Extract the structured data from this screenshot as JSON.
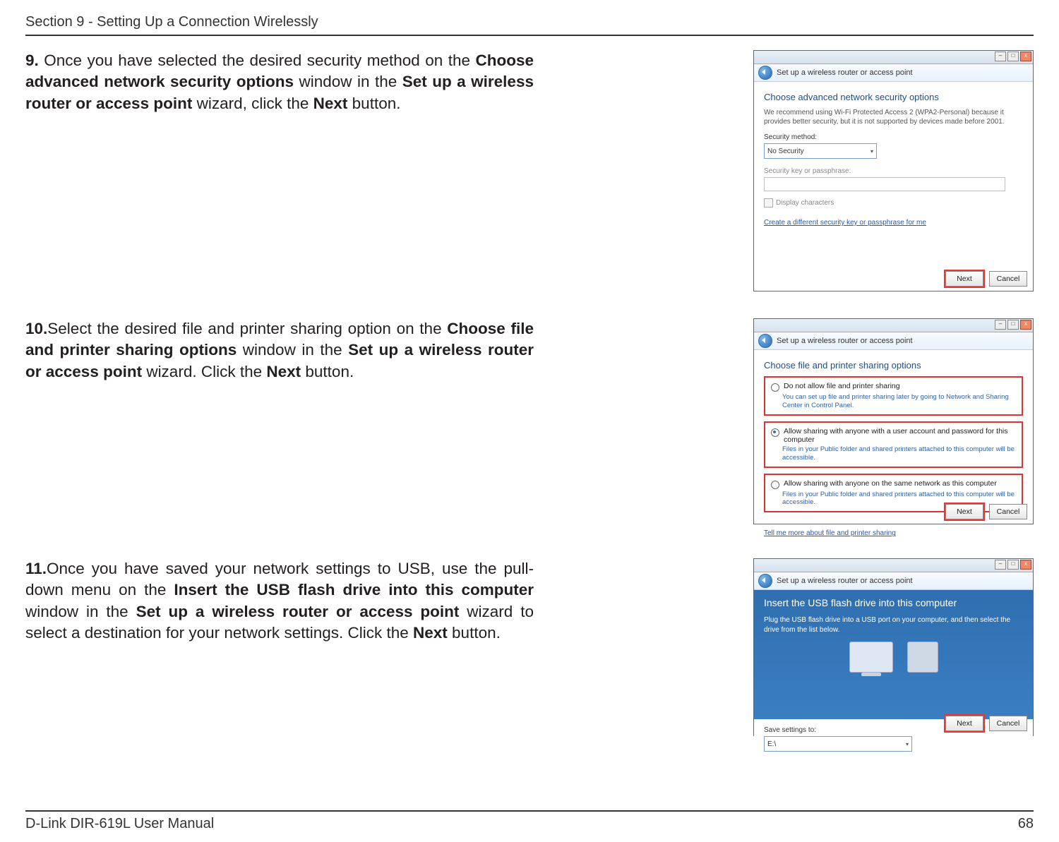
{
  "header": {
    "section": "Section 9 - Setting Up a Connection Wirelessly"
  },
  "footer": {
    "manual": "D-Link DIR-619L User Manual",
    "page": "68"
  },
  "step9": {
    "num": "9. ",
    "t1": "Once you have selected the desired security method on the ",
    "b1": "Choose advanced network security options",
    "t2": " window in the ",
    "b2": "Set up a wireless router or access point",
    "t3": " wizard, click the ",
    "b3": "Next",
    "t4": " button."
  },
  "step10": {
    "num": "10.",
    "t1": "Select the desired file and printer sharing option on the ",
    "b1": "Choose file and printer sharing options",
    "t2": " window in the ",
    "b2": "Set up a wireless router or access point",
    "t3": " wizard. Click the ",
    "b3": "Next",
    "t4": " button."
  },
  "step11": {
    "num": "11.",
    "t1": "Once you have saved your network settings to USB, use the pull-down menu on the ",
    "b1": "Insert the USB flash drive into this computer",
    "t2": " window in the ",
    "b2": "Set up a wireless router or access point",
    "t3": " wizard to select a destination for your network settings. Click the ",
    "b3": "Next",
    "t4": " button."
  },
  "shot1": {
    "wizard_title": "Set up a wireless router or access point",
    "heading": "Choose advanced network security options",
    "sub": "We recommend using Wi-Fi Protected Access 2 (WPA2-Personal) because it provides better security,  but it is not supported by devices made before 2001.",
    "method_label": "Security method:",
    "method_value": "No Security",
    "passphrase_label": "Security key or passphrase:",
    "display_chars": "Display characters",
    "link": "Create a different security key or passphrase for me",
    "next": "Next",
    "cancel": "Cancel"
  },
  "shot2": {
    "wizard_title": "Set up a wireless router or access point",
    "heading": "Choose file and printer sharing options",
    "opt1_title": "Do not allow file and printer sharing",
    "opt1_desc": "You can set up file and printer sharing later by going to Network and Sharing Center in Control Panel.",
    "opt2_title": "Allow sharing with anyone with a user account and password for this computer",
    "opt2_desc": "Files in your Public folder and shared printers attached to this computer will be accessible.",
    "opt3_title": "Allow sharing with anyone on the same network as this computer",
    "opt3_desc": "Files in your Public folder and shared printers attached to this computer will be accessible.",
    "link": "Tell me more about file and printer sharing",
    "next": "Next",
    "cancel": "Cancel"
  },
  "shot3": {
    "wizard_title": "Set up a wireless router or access point",
    "heading": "Insert the USB flash drive into this computer",
    "sub": "Plug the USB flash drive into a USB port on your computer, and then select the drive from the list below.",
    "save_label": "Save settings to:",
    "drive_value": "E:\\",
    "next": "Next",
    "cancel": "Cancel"
  }
}
